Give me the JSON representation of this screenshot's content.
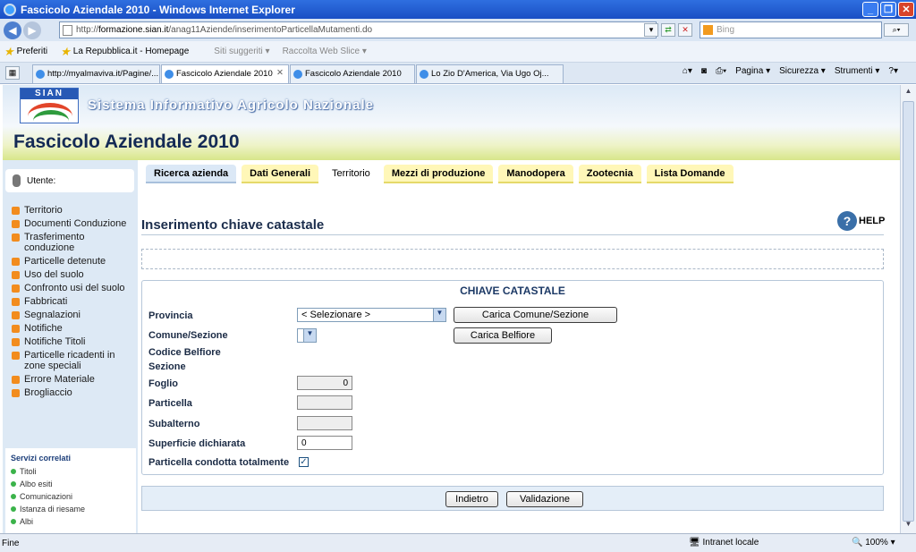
{
  "window": {
    "title": "Fascicolo Aziendale 2010 - Windows Internet Explorer"
  },
  "address": {
    "url_prefix": "http://",
    "url_host": "formazione.sian.it",
    "url_path": "/anag11Aziende/inserimentoParticellaMutamenti.do"
  },
  "search": {
    "placeholder": "Bing"
  },
  "favorites": {
    "label": "Preferiti",
    "items": [
      "La Repubblica.it - Homepage",
      "Siti suggeriti ▾",
      "Raccolta Web Slice ▾"
    ]
  },
  "tabs": [
    "http://myalmaviva.it/Pagine/...",
    "Fascicolo Aziendale 2010",
    "Fascicolo Aziendale 2010",
    "Lo Zio D'America, Via Ugo Oj..."
  ],
  "commands": [
    "Pagina ▾",
    "Sicurezza ▾",
    "Strumenti ▾"
  ],
  "banner": {
    "logo": "SIAN",
    "system": "Sistema Informativo Agricolo Nazionale",
    "app_title": "Fascicolo Aziendale 2010"
  },
  "user": {
    "label": "Utente:"
  },
  "menu": [
    "Territorio",
    "Documenti Conduzione",
    "Trasferimento conduzione",
    "Particelle detenute",
    "Uso del suolo",
    "Confronto usi del suolo",
    "Fabbricati",
    "Segnalazioni",
    "Notifiche",
    "Notifiche Titoli",
    "Particelle ricadenti in zone speciali",
    "Errore Materiale",
    "Brogliaccio"
  ],
  "services": {
    "title": "Servizi correlati",
    "items": [
      "Titoli",
      "Albo esiti",
      "Comunicazioni",
      "Istanza di riesame",
      "Albi"
    ]
  },
  "nav": [
    "Ricerca azienda",
    "Dati Generali",
    "Territorio",
    "Mezzi di produzione",
    "Manodopera",
    "Zootecnia",
    "Lista Domande"
  ],
  "section": {
    "title": "Inserimento chiave catastale",
    "help": "HELP"
  },
  "form": {
    "title": "CHIAVE CATASTALE",
    "provincia_label": "Provincia",
    "provincia_value": "< Selezionare >",
    "comune_label": "Comune/Sezione",
    "belfiore_label": "Codice Belfiore",
    "sezione_label": "Sezione",
    "foglio_label": "Foglio",
    "foglio_value": "0",
    "particella_label": "Particella",
    "subalterno_label": "Subalterno",
    "superficie_label": "Superficie dichiarata",
    "superficie_value": "0",
    "condotta_label": "Particella condotta totalmente",
    "carica_comune": "Carica Comune/Sezione",
    "carica_belfiore": "Carica Belfiore"
  },
  "buttons": {
    "back": "Indietro",
    "validate": "Validazione"
  },
  "status": {
    "left": "Fine",
    "zone": "Intranet locale",
    "zoom": "100%"
  }
}
